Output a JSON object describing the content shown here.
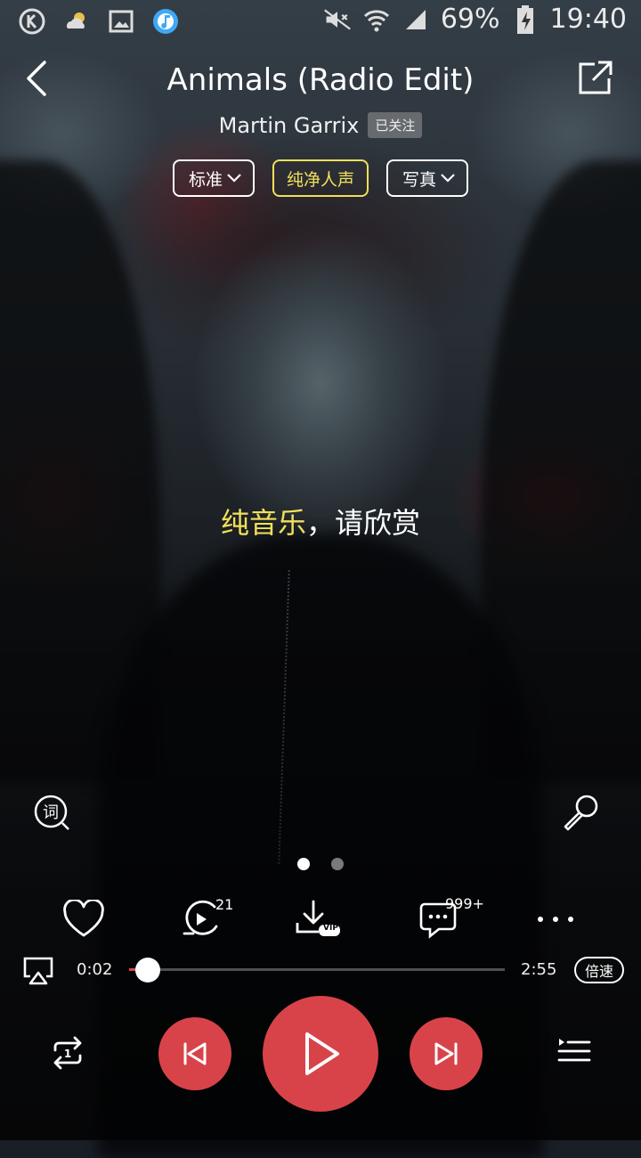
{
  "status_bar": {
    "battery": "69%",
    "time": "19:40"
  },
  "header": {
    "title": "Animals (Radio Edit)",
    "artist": "Martin Garrix",
    "follow_label": "已关注"
  },
  "chips": [
    {
      "label": "标准",
      "has_dropdown": true,
      "active": false
    },
    {
      "label": "纯净人声",
      "has_dropdown": false,
      "active": true
    },
    {
      "label": "写真",
      "has_dropdown": true,
      "active": false
    }
  ],
  "lyric": {
    "highlight": "纯音乐",
    "rest": "，请欣赏"
  },
  "pager": {
    "count": 2,
    "active": 0
  },
  "actions": {
    "like_icon": "heart-icon",
    "video_count": "21",
    "download_badge": "VIP",
    "comment_count": "999+",
    "more_icon": "more-icon"
  },
  "progress": {
    "current": "0:02",
    "total": "2:55",
    "fraction": 0.05,
    "speed_label": "倍速"
  },
  "colors": {
    "accent": "#d8434a",
    "highlight": "#f1e05a"
  }
}
